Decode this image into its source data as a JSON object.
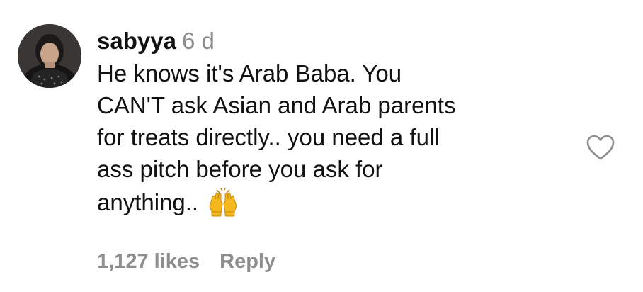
{
  "comment": {
    "username": "sabyya",
    "timestamp": "6 d",
    "text_lines": [
      "He knows it's Arab Baba. You",
      "CAN'T ask Asian and Arab parents",
      "for treats directly.. you need a full",
      "ass pitch before you ask for",
      "anything.."
    ],
    "emoji": "raising-hands-emoji",
    "likes": "1,127 likes",
    "reply_label": "Reply",
    "like_icon": "heart-outline-icon",
    "colors": {
      "text": "#111111",
      "secondary": "#8e8e8e",
      "emoji": "#f5b81f"
    }
  }
}
